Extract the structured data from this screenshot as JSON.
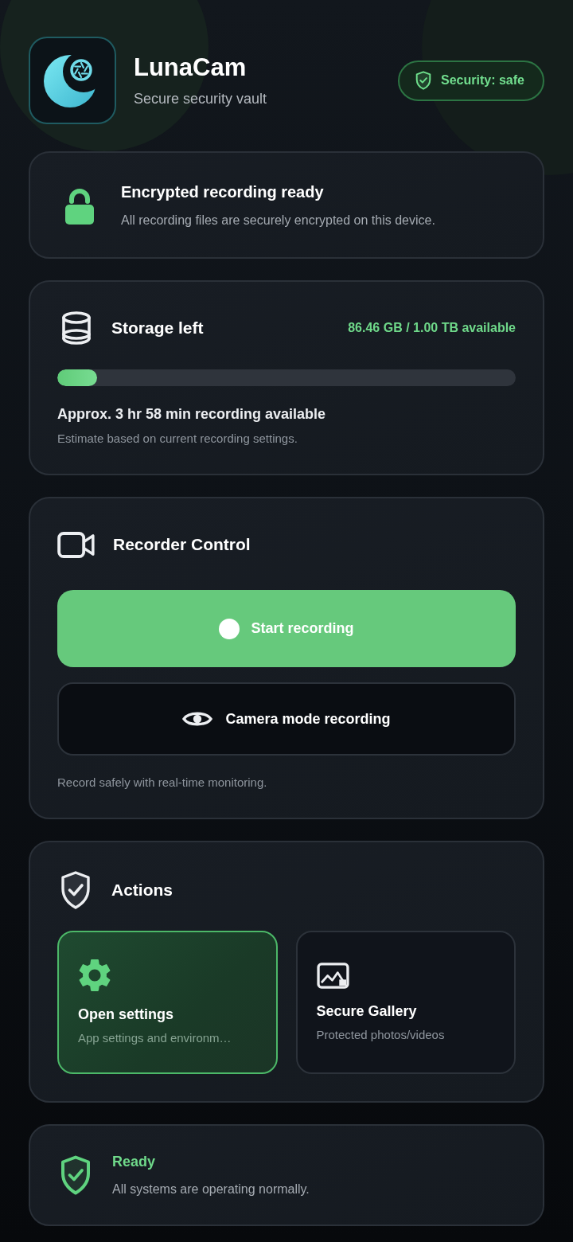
{
  "header": {
    "app_name": "LunaCam",
    "subtitle": "Secure security vault",
    "badge": {
      "label": "Security: safe"
    }
  },
  "encryption_card": {
    "title": "Encrypted recording ready",
    "description": "All recording files are securely encrypted on this device."
  },
  "storage_card": {
    "title": "Storage left",
    "capacity": "86.46 GB / 1.00 TB available",
    "level": 0.086,
    "estimate": "Approx. 3 hr 58 min recording available",
    "note": "Estimate based on current recording settings."
  },
  "recorder_card": {
    "title": "Recorder Control",
    "buttons": [
      {
        "kind": "primary",
        "label": "Start recording"
      },
      {
        "kind": "secondary",
        "label": "Camera mode recording"
      }
    ],
    "note": "Record safely with real-time monitoring."
  },
  "actions_card": {
    "title": "Actions",
    "items": [
      {
        "kind": "settings",
        "title": "Open settings",
        "subtitle": "App settings and environm…",
        "selected": true
      },
      {
        "kind": "gallery",
        "title": "Secure Gallery",
        "subtitle": "Protected photos/videos",
        "selected": false
      }
    ]
  },
  "status_card": {
    "title": "Ready",
    "description": "All systems are operating normally."
  }
}
